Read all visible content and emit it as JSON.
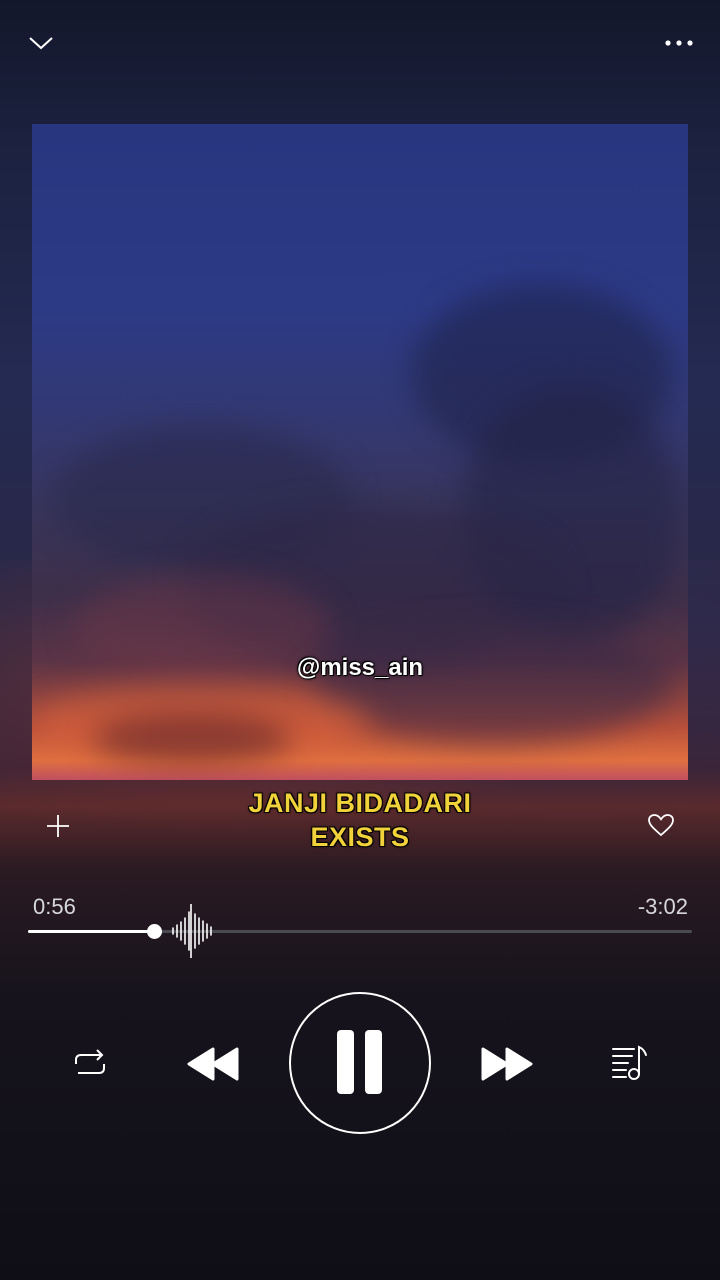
{
  "header": {
    "collapse_icon": "chevron-down-icon",
    "more_icon": "more-dots-icon"
  },
  "cover": {
    "handle": "@miss_ain"
  },
  "track": {
    "title_line1": "JANJI BIDADARI",
    "title_line2": "EXISTS",
    "title_color": "#f1d23a"
  },
  "progress": {
    "elapsed": "0:56",
    "remaining": "-3:02",
    "fraction": 0.19
  },
  "controls": {
    "repeat_icon": "repeat-icon",
    "previous_icon": "rewind-icon",
    "pause_icon": "pause-icon",
    "next_icon": "fast-forward-icon",
    "queue_icon": "playlist-icon",
    "add_icon": "plus-icon",
    "like_icon": "heart-icon"
  }
}
